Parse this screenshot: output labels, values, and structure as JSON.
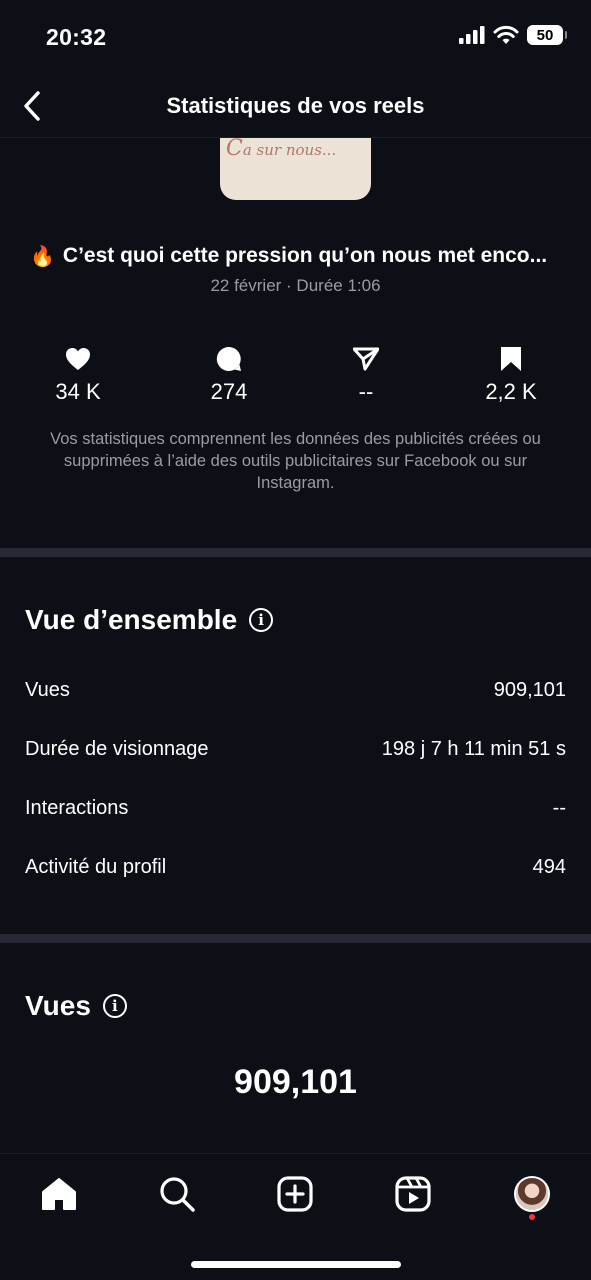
{
  "status_bar": {
    "time": "20:32",
    "battery": "50",
    "icons": [
      "signal-icon",
      "wifi-icon",
      "battery-icon"
    ]
  },
  "header": {
    "title": "Statistiques de vos reels",
    "back_icon": "chevron-left-icon"
  },
  "thumbnail": {
    "text": "a sur nous..."
  },
  "reel": {
    "emoji": "🔥",
    "title": "C’est quoi cette pression qu’on nous met enco...",
    "meta": "22 février · Durée 1:06"
  },
  "stats": [
    {
      "icon": "heart-icon",
      "value": "34 K"
    },
    {
      "icon": "comment-icon",
      "value": "274"
    },
    {
      "icon": "share-icon",
      "value": "--"
    },
    {
      "icon": "bookmark-icon",
      "value": "2,2 K"
    }
  ],
  "disclaimer": "Vos statistiques comprennent les données des publicités créées ou supprimées à l’aide des outils publicitaires sur Facebook ou sur Instagram.",
  "overview": {
    "title": "Vue d’ensemble",
    "info_glyph": "i",
    "rows": [
      {
        "label": "Vues",
        "value": "909,101"
      },
      {
        "label": "Durée de visionnage",
        "value": "198 j 7 h 11 min 51 s"
      },
      {
        "label": "Interactions",
        "value": "--"
      },
      {
        "label": "Activité du profil",
        "value": "494"
      }
    ]
  },
  "views": {
    "title": "Vues",
    "info_glyph": "i",
    "total": "909,101"
  },
  "tab_bar": {
    "tabs": [
      "home-icon",
      "search-icon",
      "create-icon",
      "reels-icon",
      "profile-avatar"
    ]
  },
  "colors": {
    "background": "#0d0f17",
    "divider": "#262933",
    "secondary_text": "#9a9ca5",
    "notification_dot": "#ff3040"
  }
}
